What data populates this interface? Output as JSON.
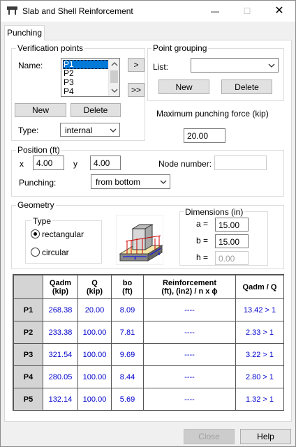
{
  "window": {
    "title": "Slab and Shell Reinforcement",
    "icon": "slab-icon",
    "minimize": "—",
    "maximize": "☐",
    "close": "✕"
  },
  "tab": {
    "label": "Punching"
  },
  "verification": {
    "group_label": "Verification points",
    "name_label": "Name:",
    "points": [
      "P1",
      "P2",
      "P3",
      "P4"
    ],
    "selected": "P1",
    "move_one": ">",
    "move_all": ">>",
    "new_label": "New",
    "delete_label": "Delete",
    "type_label": "Type:",
    "type_value": "internal"
  },
  "grouping": {
    "group_label": "Point grouping",
    "list_label": "List:",
    "list_value": "",
    "new_label": "New",
    "delete_label": "Delete"
  },
  "max_force": {
    "label": "Maximum punching force (kip)",
    "value": "20.00"
  },
  "position": {
    "group_label": "Position (ft)",
    "x_label": "x",
    "x_value": "4.00",
    "y_label": "y",
    "y_value": "4.00",
    "node_label": "Node number:",
    "node_value": "",
    "punching_label": "Punching:",
    "punching_value": "from bottom"
  },
  "geometry": {
    "group_label": "Geometry",
    "type_label": "Type",
    "rectangular": "rectangular",
    "circular": "circular",
    "selected_type": "rectangular",
    "image": "column-punching-diagram",
    "dims_label": "Dimensions (in)",
    "a_label": "a =",
    "a_value": "15.00",
    "b_label": "b =",
    "b_value": "15.00",
    "h_label": "h =",
    "h_value": "0.00"
  },
  "table": {
    "headers": [
      "Qadm\n(kip)",
      "Q\n(kip)",
      "bo\n(ft)",
      "Reinforcement\n(ft), (in2) / n x ϕ",
      "Qadm / Q"
    ],
    "rows": [
      {
        "name": "P1",
        "qadm": "268.38",
        "q": "20.00",
        "bo": "8.09",
        "reinf": "----",
        "ratio": "13.42 > 1"
      },
      {
        "name": "P2",
        "qadm": "233.38",
        "q": "100.00",
        "bo": "7.81",
        "reinf": "----",
        "ratio": "2.33 > 1"
      },
      {
        "name": "P3",
        "qadm": "321.54",
        "q": "100.00",
        "bo": "9.69",
        "reinf": "----",
        "ratio": "3.22 > 1"
      },
      {
        "name": "P4",
        "qadm": "280.05",
        "q": "100.00",
        "bo": "8.44",
        "reinf": "----",
        "ratio": "2.80 > 1"
      },
      {
        "name": "P5",
        "qadm": "132.14",
        "q": "100.00",
        "bo": "5.69",
        "reinf": "----",
        "ratio": "1.32 > 1"
      }
    ]
  },
  "footer": {
    "close_label": "Close",
    "help_label": "Help"
  }
}
